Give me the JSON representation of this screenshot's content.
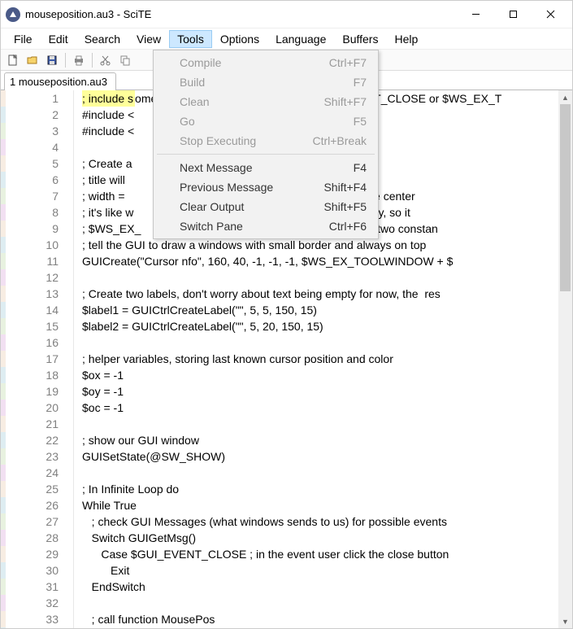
{
  "window": {
    "title": "mouseposition.au3 - SciTE"
  },
  "menubar": [
    "File",
    "Edit",
    "Search",
    "View",
    "Tools",
    "Options",
    "Language",
    "Buffers",
    "Help"
  ],
  "menubar_open_index": 4,
  "tabbar": {
    "tab1": "1 mouseposition.au3"
  },
  "dropdown": {
    "items": [
      {
        "label": "Compile",
        "shortcut": "Ctrl+F7",
        "disabled": true
      },
      {
        "label": "Build",
        "shortcut": "F7",
        "disabled": true
      },
      {
        "label": "Clean",
        "shortcut": "Shift+F7",
        "disabled": true
      },
      {
        "label": "Go",
        "shortcut": "F5",
        "disabled": true
      },
      {
        "label": "Stop Executing",
        "shortcut": "Ctrl+Break",
        "disabled": true
      },
      {
        "sep": true
      },
      {
        "label": "Next Message",
        "shortcut": "F4"
      },
      {
        "label": "Previous Message",
        "shortcut": "Shift+F4"
      },
      {
        "label": "Clear Output",
        "shortcut": "Shift+F5"
      },
      {
        "label": "Switch Pane",
        "shortcut": "Ctrl+F6"
      }
    ]
  },
  "code": {
    "lines": [
      "; include some constants - we nee                              VENT_CLOSE or $WS_EX_T",
      "#include <",
      "#include <",
      "",
      "; Create a",
      "; title will",
      "; width =                                                 s the window will be center",
      "; it's like w                                               t the window exactly, so it",
      "; $WS_EX_                                                   ST - these are two constan",
      "; tell the GUI to draw a windows with small border and always on top",
      "GUICreate(\"Cursor nfo\", 160, 40, -1, -1, -1, $WS_EX_TOOLWINDOW + $",
      "",
      "; Create two labels, don't worry about text being empty for now, the  res",
      "$label1 = GUICtrlCreateLabel(\"\", 5, 5, 150, 15)",
      "$label2 = GUICtrlCreateLabel(\"\", 5, 20, 150, 15)",
      "",
      "; helper variables, storing last known cursor position and color",
      "$ox = -1",
      "$oy = -1",
      "$oc = -1",
      "",
      "; show our GUI window",
      "GUISetState(@SW_SHOW)",
      "",
      "; In Infinite Loop do",
      "While True",
      "   ; check GUI Messages (what windows sends to us) for possible events",
      "   Switch GUIGetMsg()",
      "      Case $GUI_EVENT_CLOSE ; in the event user click the close button",
      "         Exit",
      "   EndSwitch",
      "",
      "   ; call function MousePos"
    ],
    "highlight_line": 0,
    "highlight_text": "; include s"
  }
}
